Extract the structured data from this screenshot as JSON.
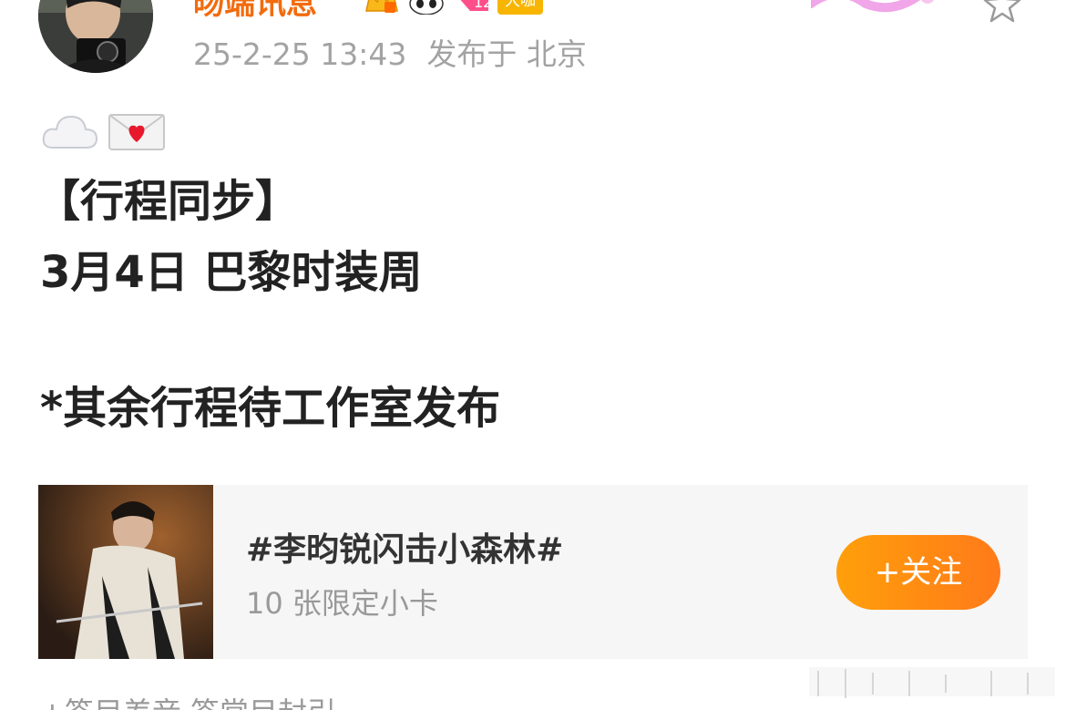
{
  "header": {
    "username": "旸端讯息",
    "badges": [
      "crown-badge",
      "panda-badge",
      "tag-badge"
    ],
    "vip_badge_text": "大咖",
    "timestamp": "25-2-25 13:43",
    "location": "发布于 北京"
  },
  "post": {
    "emojis": [
      "cloud-emoji",
      "love-letter-emoji"
    ],
    "line1": "【行程同步】",
    "line2": "3月4日  巴黎时装周",
    "line3": "*其余行程待工作室发布"
  },
  "topic_card": {
    "title": "#李昀锐闪击小森林#",
    "subtitle": "10 张限定小卡",
    "follow_label": "+关注"
  },
  "footer": {
    "cut_text": "+签目差音  签常目封引"
  },
  "colors": {
    "username": "#f26b0d",
    "meta": "#a3a3a3",
    "body_text": "#222222",
    "card_bg": "#f6f6f6",
    "follow_gradient_start": "#ff9f0a",
    "follow_gradient_end": "#ff7a1a",
    "vip_badge": "#f7b500"
  }
}
